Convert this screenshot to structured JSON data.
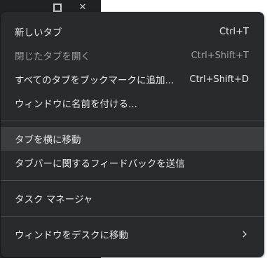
{
  "caption": {
    "maximize_icon": "maximize-icon",
    "close_icon": "close-icon",
    "close_glyph": "✕"
  },
  "menu": {
    "new_tab": {
      "label": "新しいタブ",
      "shortcut": "Ctrl+T"
    },
    "reopen_closed_tab": {
      "label": "閉じたタブを開く",
      "shortcut": "Ctrl+Shift+T"
    },
    "bookmark_all_tabs": {
      "label": "すべてのタブをブックマークに追加...",
      "shortcut": "Ctrl+Shift+D"
    },
    "name_window": {
      "label": "ウィンドウに名前を付ける..."
    },
    "move_tab_sideways": {
      "label": "タブを横に移動"
    },
    "tab_bar_feedback": {
      "label": "タブバーに関するフィードバックを送信"
    },
    "task_manager": {
      "label": "タスク マネージャ"
    },
    "move_window_to_desk": {
      "label": "ウィンドウをデスクに移動",
      "icon": "chevron-right-icon"
    }
  },
  "colors": {
    "menu_background": "#292a2d",
    "highlight": "#3c3d41",
    "text": "#e8eaed",
    "disabled_text": "#9aa0a6",
    "separator": "#4a4b4f"
  }
}
